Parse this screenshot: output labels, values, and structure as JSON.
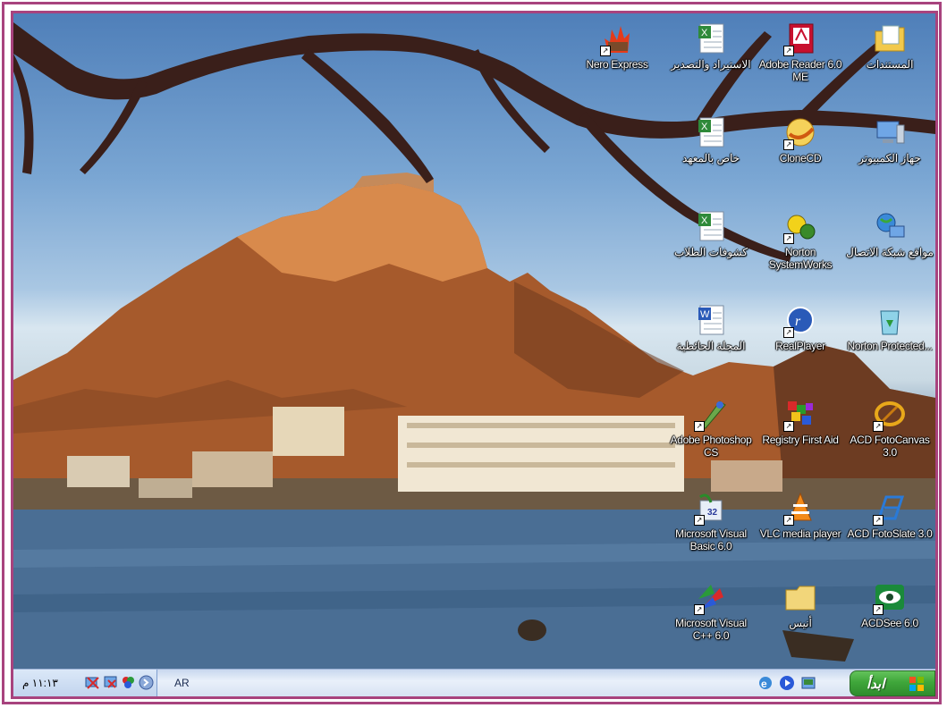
{
  "desktop_icons": [
    {
      "label": "Nero Express"
    },
    {
      "label": "الاستيراد والتصدير"
    },
    {
      "label": "Adobe Reader 6.0 ME"
    },
    {
      "label": "المستندات"
    },
    {
      "label": "خاص بالمعهد"
    },
    {
      "label": "CloneCD"
    },
    {
      "label": "جهاز الكمبيوتر"
    },
    {
      "label": "كشوفات الطلاب"
    },
    {
      "label": "Norton SystemWorks"
    },
    {
      "label": "مواقع شبكة الاتصال"
    },
    {
      "label": "المجلة الحائطية"
    },
    {
      "label": "RealPlayer"
    },
    {
      "label": "Norton Protected..."
    },
    {
      "label": "Adobe Photoshop CS"
    },
    {
      "label": "Registry First Aid"
    },
    {
      "label": "ACD FotoCanvas 3.0"
    },
    {
      "label": "Microsoft Visual Basic 6.0"
    },
    {
      "label": "VLC media player"
    },
    {
      "label": "ACD FotoSlate 3.0"
    },
    {
      "label": "Microsoft Visual C++ 6.0"
    },
    {
      "label": "أنيس"
    },
    {
      "label": "ACDSee 6.0"
    }
  ],
  "taskbar": {
    "clock": "١١:١٣ م",
    "language": "AR",
    "start_label": "ابدأ"
  },
  "colors": {
    "frame": "#a8437e",
    "start_button": "#3fa63a",
    "taskbar": "#d6e2f3"
  }
}
